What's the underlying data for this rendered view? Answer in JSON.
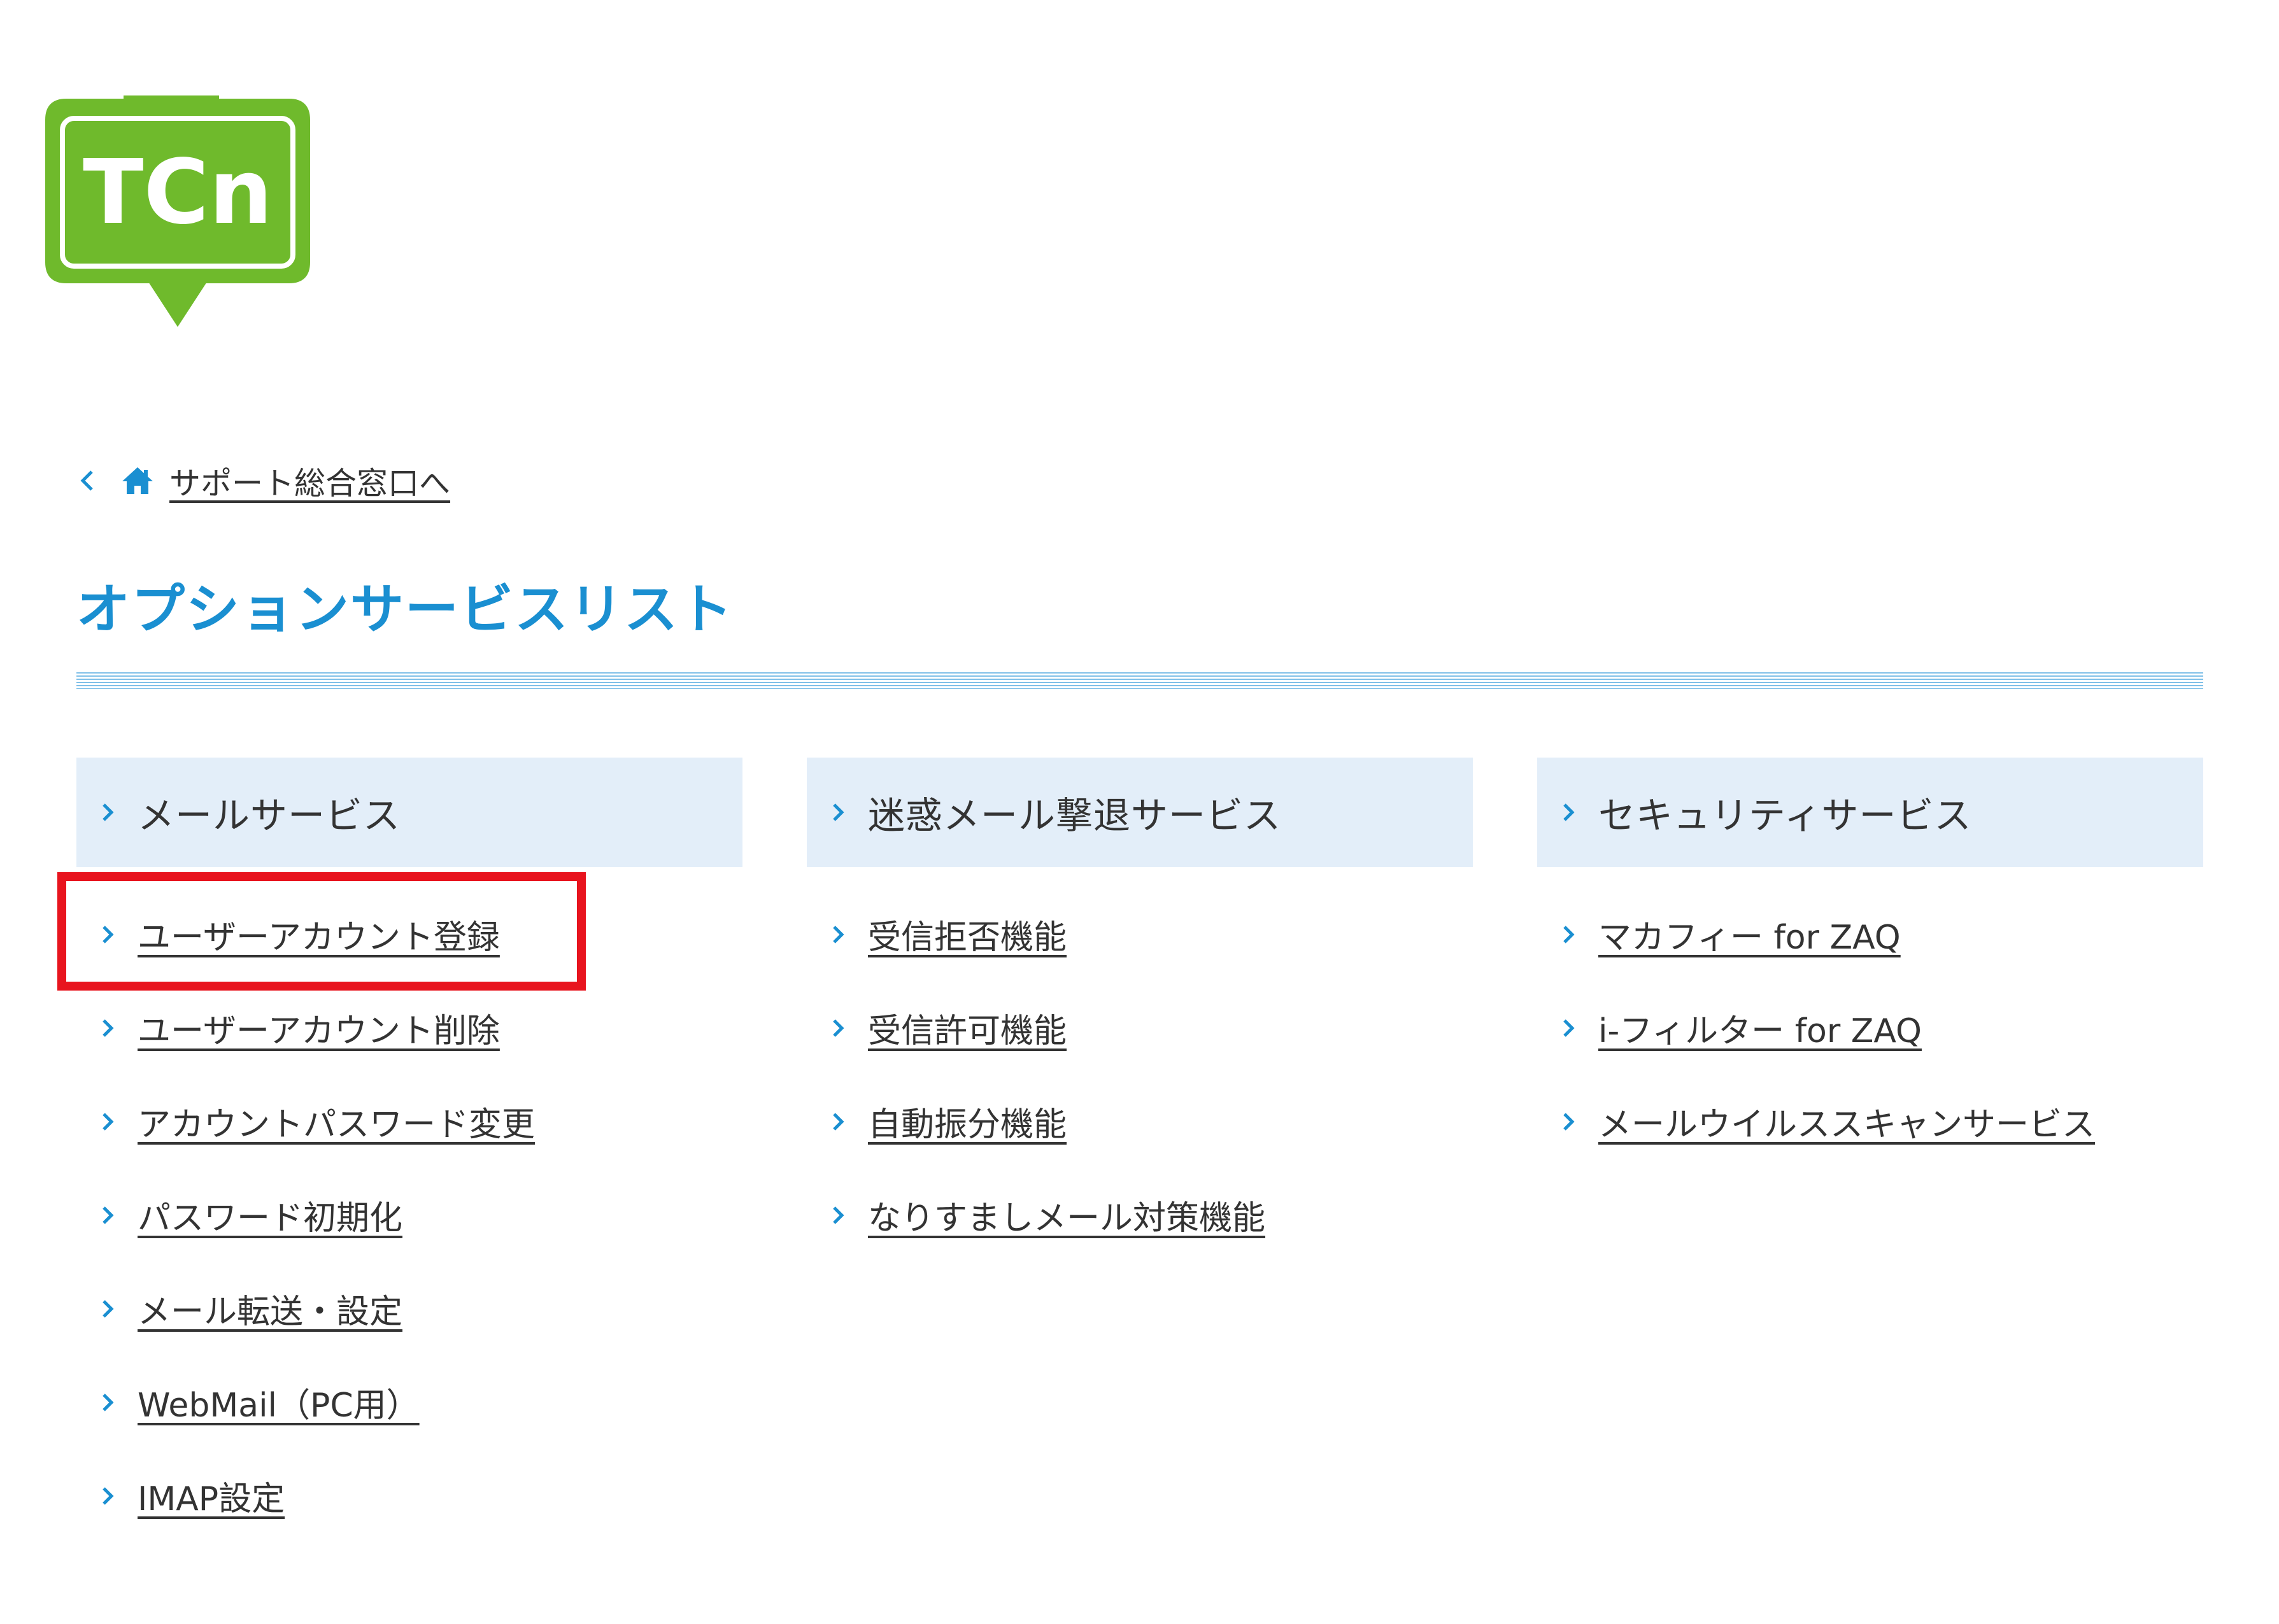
{
  "logo": {
    "text": "TCn",
    "color": "#6fba2c"
  },
  "breadcrumb": {
    "back_icon": "chevron-left-icon",
    "home_icon": "home-icon",
    "label": "サポート総合窓口へ"
  },
  "page_title": "オプションサービスリスト",
  "accent_color": "#1a8fd1",
  "highlight_color": "#e8141e",
  "columns": [
    {
      "header": "メールサービス",
      "items": [
        {
          "label": "ユーザーアカウント登録"
        },
        {
          "label": "ユーザーアカウント削除"
        },
        {
          "label": "アカウントパスワード変更"
        },
        {
          "label": "パスワード初期化"
        },
        {
          "label": "メール転送・設定"
        },
        {
          "label": "WebMail（PC用）"
        },
        {
          "label": "IMAP設定"
        }
      ]
    },
    {
      "header": "迷惑メール撃退サービス",
      "items": [
        {
          "label": "受信拒否機能"
        },
        {
          "label": "受信許可機能"
        },
        {
          "label": "自動振分機能"
        },
        {
          "label": "なりすましメール対策機能"
        }
      ]
    },
    {
      "header": "セキュリティサービス",
      "items": [
        {
          "label": "マカフィー for ZAQ"
        },
        {
          "label": "i-フィルター for ZAQ"
        },
        {
          "label": "メールウイルススキャンサービス"
        }
      ]
    }
  ]
}
